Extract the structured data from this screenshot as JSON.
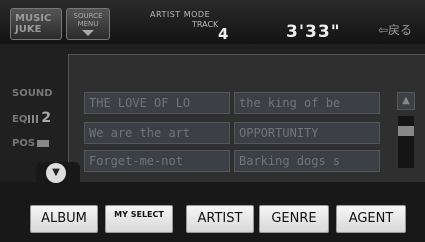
{
  "header": {
    "music_juke": "MUSIC JUKE",
    "source_menu": "SOURCE MENU",
    "mode": "ARTIST MODE",
    "track_label": "TRACK",
    "track_number": "4",
    "time": "3'33\"",
    "back": "⇦戻る"
  },
  "sidebar": {
    "sound": "SOUND",
    "eq": "EQ",
    "eq_value": "2",
    "pos": "POS"
  },
  "list": {
    "items": [
      "THE LOVE OF LO",
      "the king of be",
      "We are the art",
      "OPPORTUNITY",
      "Forget-me-not",
      "Barking dogs s"
    ]
  },
  "buttons": {
    "album": "ALBUM",
    "my_select": "MY SELECT",
    "artist": "ARTIST",
    "genre": "GENRE",
    "agent": "AGENT"
  }
}
